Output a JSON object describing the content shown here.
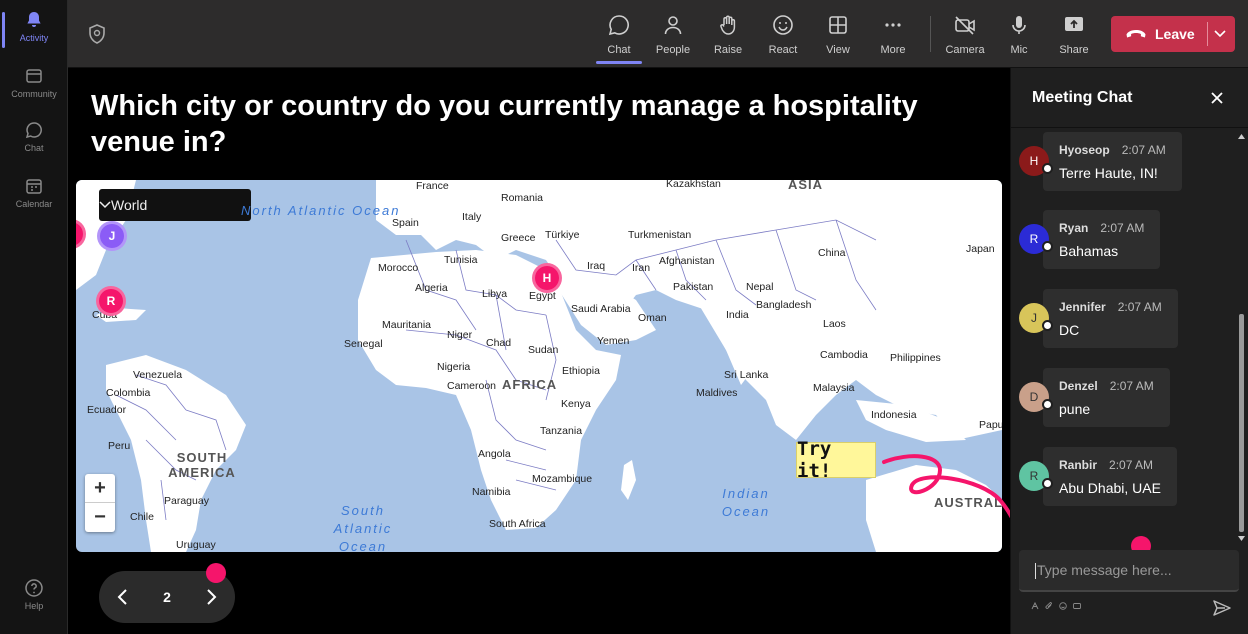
{
  "rail": [
    {
      "label": "Activity",
      "icon": "bell-icon"
    },
    {
      "label": "Community",
      "icon": "community-icon"
    },
    {
      "label": "Chat",
      "icon": "chat-icon"
    },
    {
      "label": "Calendar",
      "icon": "calendar-icon"
    },
    {
      "label": "Help",
      "icon": "help-icon"
    }
  ],
  "toolbar": {
    "chat": "Chat",
    "people": "People",
    "raise": "Raise",
    "react": "React",
    "view": "View",
    "more": "More",
    "camera": "Camera",
    "mic": "Mic",
    "share": "Share",
    "leave": "Leave"
  },
  "question": "Which city or country do you currently manage a hospitality venue in?",
  "map": {
    "selector": "World",
    "zoom_in": "+",
    "zoom_out": "−",
    "regions": [
      "ASIA",
      "AFRICA",
      "SOUTH AMERICA",
      "AUSTRALIA"
    ],
    "oceans": [
      "North Atlantic Ocean",
      "South Atlantic Ocean",
      "Indian Ocean"
    ],
    "places": [
      "France",
      "Kazakhstan",
      "Romania",
      "Spain",
      "Italy",
      "Greece",
      "Türkiye",
      "Turkmenistan",
      "China",
      "Japan",
      "Tunisia",
      "Morocco",
      "Iraq",
      "Iran",
      "Afghanistan",
      "Algeria",
      "Libya",
      "Egypt",
      "Pakistan",
      "Nepal",
      "Saudi Arabia",
      "Bangladesh",
      "India",
      "Oman",
      "Laos",
      "Mauritania",
      "Niger",
      "Senegal",
      "Chad",
      "Sudan",
      "Yemen",
      "Cambodia",
      "Philippines",
      "Nigeria",
      "Venezuela",
      "Cameroon",
      "Ethiopia",
      "Sri Lanka",
      "Malaysia",
      "Colombia",
      "Maldives",
      "Ecuador",
      "Kenya",
      "Indonesia",
      "Tanzania",
      "Peru",
      "Papua",
      "Angola",
      "Mozambique",
      "Namibia",
      "Paraguay",
      "Chile",
      "South Africa",
      "Uruguay",
      "Cuba"
    ],
    "pins": [
      {
        "letter": "J",
        "color": "#8b5cf6"
      },
      {
        "letter": "R",
        "color": "#f5156b"
      },
      {
        "letter": "H",
        "color": "#f5156b"
      }
    ]
  },
  "callout": "Try it!",
  "pager": {
    "page": "2"
  },
  "chat": {
    "title": "Meeting Chat",
    "messages": [
      {
        "name": "Hyoseop",
        "time": "2:07 AM",
        "text": "Terre Haute, IN!",
        "initial": "H",
        "color": "#8b1a1a"
      },
      {
        "name": "Ryan",
        "time": "2:07 AM",
        "text": "Bahamas",
        "initial": "R",
        "color": "#2b2bd6"
      },
      {
        "name": "Jennifer",
        "time": "2:07 AM",
        "text": "DC",
        "initial": "J",
        "color": "#d8c55a"
      },
      {
        "name": "Denzel",
        "time": "2:07 AM",
        "text": "pune",
        "initial": "D",
        "color": "#c9a08a"
      },
      {
        "name": "Ranbir",
        "time": "2:07 AM",
        "text": "Abu Dhabi, UAE",
        "initial": "R",
        "color": "#5fc4a2"
      }
    ],
    "placeholder": "Type message here..."
  }
}
